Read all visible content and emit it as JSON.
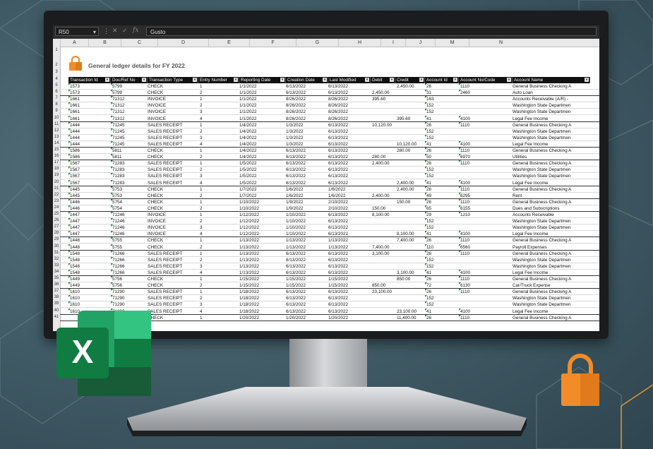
{
  "formula_bar": {
    "cell_ref": "R50",
    "formula": "Gusto"
  },
  "columns": [
    "A",
    "B",
    "C",
    "D",
    "E",
    "F",
    "G",
    "H",
    "I",
    "J",
    "M",
    "N"
  ],
  "report_title": "General ledger details for FY 2022",
  "table_headers": [
    "Transaction Id",
    "Doc/Ref No",
    "Transaction Type",
    "Entry Number",
    "Reporting Date",
    "Creation Date",
    "Last Modified",
    "Debit",
    "Credit",
    "Account Id",
    "Account No/Code",
    "Account Name"
  ],
  "rows": [
    [
      "1573",
      "5799",
      "CHECK",
      "1",
      "1/1/2022",
      "6/13/2022",
      "6/13/2022",
      "",
      "2,450.00",
      "26",
      "1110",
      "General Business Checking A"
    ],
    [
      "1573",
      "5799",
      "CHECK",
      "2",
      "1/1/2022",
      "6/13/2022",
      "6/13/2022",
      "2,450.00",
      "",
      "31",
      "2460",
      "Auto Loan"
    ],
    [
      "1661",
      "71312",
      "INVOICE",
      "1",
      "1/1/2022",
      "8/26/2022",
      "8/26/2022",
      "395.60",
      "",
      "163",
      "",
      "Accounts Receivable (A/R) -"
    ],
    [
      "1661",
      "71312",
      "INVOICE",
      "2",
      "1/1/2022",
      "8/26/2022",
      "8/26/2022",
      "",
      "",
      "152",
      "",
      "Washington State Departmen"
    ],
    [
      "1661",
      "71312",
      "INVOICE",
      "3",
      "1/1/2022",
      "8/26/2022",
      "8/26/2022",
      "",
      "",
      "152",
      "",
      "Washington State Departmen"
    ],
    [
      "1661",
      "71312",
      "INVOICE",
      "4",
      "1/1/2022",
      "8/26/2022",
      "8/26/2022",
      "",
      "395.60",
      "41",
      "4100",
      "Legal Fee Income"
    ],
    [
      "1444",
      "71245",
      "SALES RECEIPT",
      "1",
      "1/4/2022",
      "1/3/2022",
      "6/13/2022",
      "10,120.00",
      "",
      "26",
      "1110",
      "General Business Checking A"
    ],
    [
      "1444",
      "71245",
      "SALES RECEIPT",
      "2",
      "1/4/2022",
      "1/3/2022",
      "6/13/2022",
      "",
      "",
      "152",
      "",
      "Washington State Departmen"
    ],
    [
      "1444",
      "71245",
      "SALES RECEIPT",
      "3",
      "1/4/2022",
      "1/3/2022",
      "6/13/2022",
      "",
      "",
      "152",
      "",
      "Washington State Departmen"
    ],
    [
      "1444",
      "71245",
      "SALES RECEIPT",
      "4",
      "1/4/2022",
      "1/3/2022",
      "6/13/2022",
      "",
      "10,120.00",
      "41",
      "4100",
      "Legal Fee Income"
    ],
    [
      "1586",
      "5811",
      "CHECK",
      "1",
      "1/4/2022",
      "6/13/2022",
      "6/13/2022",
      "",
      "280.00",
      "26",
      "1110",
      "General Business Checking A"
    ],
    [
      "1586",
      "5811",
      "CHECK",
      "2",
      "1/4/2022",
      "6/13/2022",
      "6/13/2022",
      "280.00",
      "",
      "50",
      "6970",
      "Utilities"
    ],
    [
      "1567",
      "71283",
      "SALES RECEIPT",
      "1",
      "1/5/2022",
      "6/13/2022",
      "6/13/2022",
      "2,400.00",
      "",
      "26",
      "1110",
      "General Business Checking A"
    ],
    [
      "1567",
      "71283",
      "SALES RECEIPT",
      "2",
      "1/5/2022",
      "6/13/2022",
      "6/13/2022",
      "",
      "",
      "152",
      "",
      "Washington State Departmen"
    ],
    [
      "1567",
      "71283",
      "SALES RECEIPT",
      "3",
      "1/5/2022",
      "6/13/2022",
      "6/13/2022",
      "",
      "",
      "152",
      "",
      "Washington State Departmen"
    ],
    [
      "1567",
      "71283",
      "SALES RECEIPT",
      "4",
      "1/5/2022",
      "6/13/2022",
      "6/13/2022",
      "",
      "2,400.00",
      "41",
      "4100",
      "Legal Fee Income"
    ],
    [
      "1445",
      "5753",
      "CHECK",
      "1",
      "1/7/2022",
      "1/6/2022",
      "1/6/2022",
      "",
      "2,400.00",
      "26",
      "1110",
      "General Business Checking A"
    ],
    [
      "1445",
      "5753",
      "CHECK",
      "2",
      "1/7/2022",
      "1/6/2022",
      "1/6/2022",
      "2,400.00",
      "",
      "49",
      "6295",
      "Rent"
    ],
    [
      "1446",
      "5754",
      "CHECK",
      "1",
      "1/10/2022",
      "1/9/2022",
      "2/10/2022",
      "",
      "150.00",
      "26",
      "1110",
      "General Business Checking A"
    ],
    [
      "1446",
      "5754",
      "CHECK",
      "2",
      "1/10/2022",
      "1/9/2022",
      "2/10/2022",
      "150.00",
      "",
      "65",
      "6155",
      "Dues and Subscriptions"
    ],
    [
      "1447",
      "71246",
      "INVOICE",
      "1",
      "1/12/2022",
      "1/10/2022",
      "6/13/2022",
      "8,100.00",
      "",
      "29",
      "1210",
      "Accounts Receivable"
    ],
    [
      "1447",
      "71246",
      "INVOICE",
      "2",
      "1/12/2022",
      "1/10/2022",
      "6/13/2022",
      "",
      "",
      "152",
      "",
      "Washington State Departmen"
    ],
    [
      "1447",
      "71246",
      "INVOICE",
      "3",
      "1/12/2022",
      "1/10/2022",
      "6/13/2022",
      "",
      "",
      "152",
      "",
      "Washington State Departmen"
    ],
    [
      "1447",
      "71246",
      "INVOICE",
      "4",
      "1/12/2022",
      "1/10/2022",
      "6/13/2022",
      "",
      "8,100.00",
      "41",
      "4100",
      "Legal Fee Income"
    ],
    [
      "1448",
      "5755",
      "CHECK",
      "1",
      "1/13/2022",
      "1/13/2022",
      "1/13/2022",
      "",
      "7,400.00",
      "26",
      "1110",
      "General Business Checking A"
    ],
    [
      "1448",
      "5755",
      "CHECK",
      "2",
      "1/13/2022",
      "1/13/2022",
      "1/13/2022",
      "7,400.00",
      "",
      "110",
      "6560",
      "Payroll Expenses"
    ],
    [
      "1548",
      "71266",
      "SALES RECEIPT",
      "1",
      "1/13/2022",
      "6/13/2022",
      "6/13/2022",
      "3,100.00",
      "",
      "26",
      "1110",
      "General Business Checking A"
    ],
    [
      "1548",
      "71266",
      "SALES RECEIPT",
      "2",
      "1/13/2022",
      "6/13/2022",
      "6/13/2022",
      "",
      "",
      "152",
      "",
      "Washington State Departmen"
    ],
    [
      "1548",
      "71266",
      "SALES RECEIPT",
      "3",
      "1/13/2022",
      "6/13/2022",
      "6/13/2022",
      "",
      "",
      "152",
      "",
      "Washington State Departmen"
    ],
    [
      "1548",
      "71266",
      "SALES RECEIPT",
      "4",
      "1/13/2022",
      "6/13/2022",
      "6/13/2022",
      "",
      "3,100.00",
      "41",
      "4100",
      "Legal Fee Income"
    ],
    [
      "1449",
      "5756",
      "CHECK",
      "1",
      "1/15/2022",
      "1/15/2022",
      "1/15/2022",
      "",
      "850.00",
      "26",
      "1110",
      "General Business Checking A"
    ],
    [
      "1449",
      "5756",
      "CHECK",
      "2",
      "1/15/2022",
      "1/15/2022",
      "1/15/2022",
      "850.00",
      "",
      "72",
      "6130",
      "Car/Truck Expense"
    ],
    [
      "1610",
      "71290",
      "SALES RECEIPT",
      "1",
      "1/18/2022",
      "6/13/2022",
      "6/13/2022",
      "23,100.00",
      "",
      "26",
      "1110",
      "General Business Checking A"
    ],
    [
      "1610",
      "71290",
      "SALES RECEIPT",
      "2",
      "1/18/2022",
      "6/13/2022",
      "6/13/2022",
      "",
      "",
      "152",
      "",
      "Washington State Departmen"
    ],
    [
      "1610",
      "71290",
      "SALES RECEIPT",
      "3",
      "1/18/2022",
      "6/13/2022",
      "6/13/2022",
      "",
      "",
      "152",
      "",
      "Washington State Departmen"
    ],
    [
      "1610",
      "71290",
      "SALES RECEIPT",
      "4",
      "1/18/2022",
      "6/13/2022",
      "6/13/2022",
      "",
      "23,100.00",
      "41",
      "4100",
      "Legal Fee Income"
    ],
    [
      "",
      "",
      "CHECK",
      "1",
      "1/20/2022",
      "1/20/2022",
      "1/20/2022",
      "",
      "11,400.00",
      "26",
      "1110",
      "General Business Checking A"
    ]
  ],
  "colors": {
    "accent_green": "#1d8a3c",
    "lock_orange": "#f28c28",
    "header_bg": "#111111"
  },
  "icons": {
    "excel": "excel-logo-icon",
    "lock": "padlock-icon"
  },
  "excel_logo_letter": "X"
}
